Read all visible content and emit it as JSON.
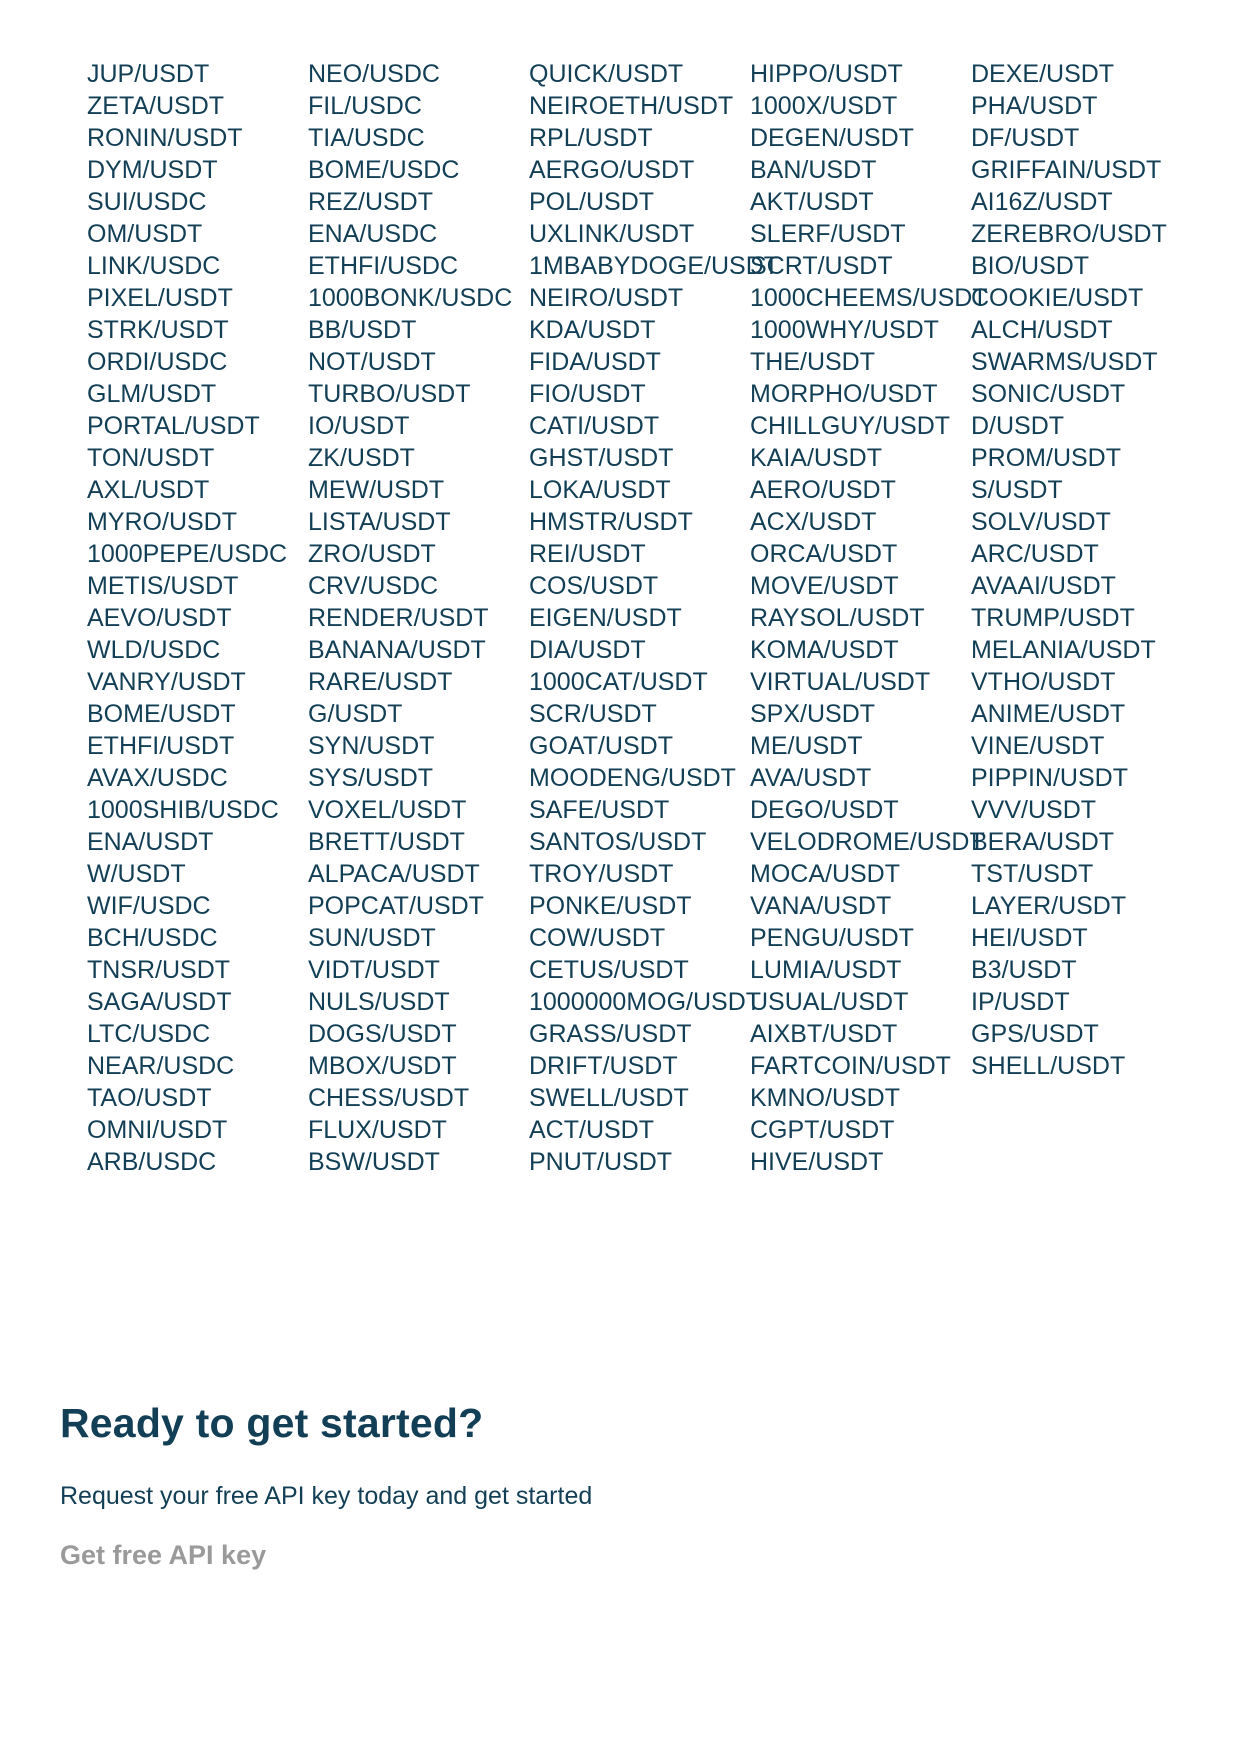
{
  "pairs_columns": [
    [
      "JUP/USDT",
      "ZETA/USDT",
      "RONIN/USDT",
      "DYM/USDT",
      "SUI/USDC",
      "OM/USDT",
      "LINK/USDC",
      "PIXEL/USDT",
      "STRK/USDT",
      "ORDI/USDC",
      "GLM/USDT",
      "PORTAL/USDT",
      "TON/USDT",
      "AXL/USDT",
      "MYRO/USDT",
      "1000PEPE/USDC",
      "METIS/USDT",
      "AEVO/USDT",
      "WLD/USDC",
      "VANRY/USDT",
      "BOME/USDT",
      "ETHFI/USDT",
      "AVAX/USDC",
      "1000SHIB/USDC",
      "ENA/USDT",
      "W/USDT",
      "WIF/USDC",
      "BCH/USDC",
      "TNSR/USDT",
      "SAGA/USDT",
      "LTC/USDC",
      "NEAR/USDC",
      "TAO/USDT",
      "OMNI/USDT",
      "ARB/USDC"
    ],
    [
      "NEO/USDC",
      "FIL/USDC",
      "TIA/USDC",
      "BOME/USDC",
      "REZ/USDT",
      "ENA/USDC",
      "ETHFI/USDC",
      "1000BONK/USDC",
      "BB/USDT",
      "NOT/USDT",
      "TURBO/USDT",
      "IO/USDT",
      "ZK/USDT",
      "MEW/USDT",
      "LISTA/USDT",
      "ZRO/USDT",
      "CRV/USDC",
      "RENDER/USDT",
      "BANANA/USDT",
      "RARE/USDT",
      "G/USDT",
      "SYN/USDT",
      "SYS/USDT",
      "VOXEL/USDT",
      "BRETT/USDT",
      "ALPACA/USDT",
      "POPCAT/USDT",
      "SUN/USDT",
      "VIDT/USDT",
      "NULS/USDT",
      "DOGS/USDT",
      "MBOX/USDT",
      "CHESS/USDT",
      "FLUX/USDT",
      "BSW/USDT"
    ],
    [
      "QUICK/USDT",
      "NEIROETH/USDT",
      "RPL/USDT",
      "AERGO/USDT",
      "POL/USDT",
      "UXLINK/USDT",
      "1MBABYDOGE/USDT",
      "NEIRO/USDT",
      "KDA/USDT",
      "FIDA/USDT",
      "FIO/USDT",
      "CATI/USDT",
      "GHST/USDT",
      "LOKA/USDT",
      "HMSTR/USDT",
      "REI/USDT",
      "COS/USDT",
      "EIGEN/USDT",
      "DIA/USDT",
      "1000CAT/USDT",
      "SCR/USDT",
      "GOAT/USDT",
      "MOODENG/USDT",
      "SAFE/USDT",
      "SANTOS/USDT",
      "TROY/USDT",
      "PONKE/USDT",
      "COW/USDT",
      "CETUS/USDT",
      "1000000MOG/USDT",
      "GRASS/USDT",
      "DRIFT/USDT",
      "SWELL/USDT",
      "ACT/USDT",
      "PNUT/USDT"
    ],
    [
      "HIPPO/USDT",
      "1000X/USDT",
      "DEGEN/USDT",
      "BAN/USDT",
      "AKT/USDT",
      "SLERF/USDT",
      "SCRT/USDT",
      "1000CHEEMS/USDT",
      "1000WHY/USDT",
      "THE/USDT",
      "MORPHO/USDT",
      "CHILLGUY/USDT",
      "KAIA/USDT",
      "AERO/USDT",
      "ACX/USDT",
      "ORCA/USDT",
      "MOVE/USDT",
      "RAYSOL/USDT",
      "KOMA/USDT",
      "VIRTUAL/USDT",
      "SPX/USDT",
      "ME/USDT",
      "AVA/USDT",
      "DEGO/USDT",
      "VELODROME/USDT",
      "MOCA/USDT",
      "VANA/USDT",
      "PENGU/USDT",
      "LUMIA/USDT",
      "USUAL/USDT",
      "AIXBT/USDT",
      "FARTCOIN/USDT",
      "KMNO/USDT",
      "CGPT/USDT",
      "HIVE/USDT"
    ],
    [
      "DEXE/USDT",
      "PHA/USDT",
      "DF/USDT",
      "GRIFFAIN/USDT",
      "AI16Z/USDT",
      "ZEREBRO/USDT",
      "BIO/USDT",
      "COOKIE/USDT",
      "ALCH/USDT",
      "SWARMS/USDT",
      "SONIC/USDT",
      "D/USDT",
      "PROM/USDT",
      "S/USDT",
      "SOLV/USDT",
      "ARC/USDT",
      "AVAAI/USDT",
      "TRUMP/USDT",
      "MELANIA/USDT",
      "VTHO/USDT",
      "ANIME/USDT",
      "VINE/USDT",
      "PIPPIN/USDT",
      "VVV/USDT",
      "BERA/USDT",
      "TST/USDT",
      "LAYER/USDT",
      "HEI/USDT",
      "B3/USDT",
      "IP/USDT",
      "GPS/USDT",
      "SHELL/USDT"
    ]
  ],
  "cta": {
    "title": "Ready to get started?",
    "subtitle": "Request your free API key today and get started",
    "link_label": "Get free API key"
  },
  "colors": {
    "text": "#123f55",
    "link_muted": "#9a9a9a",
    "background": "#ffffff"
  }
}
